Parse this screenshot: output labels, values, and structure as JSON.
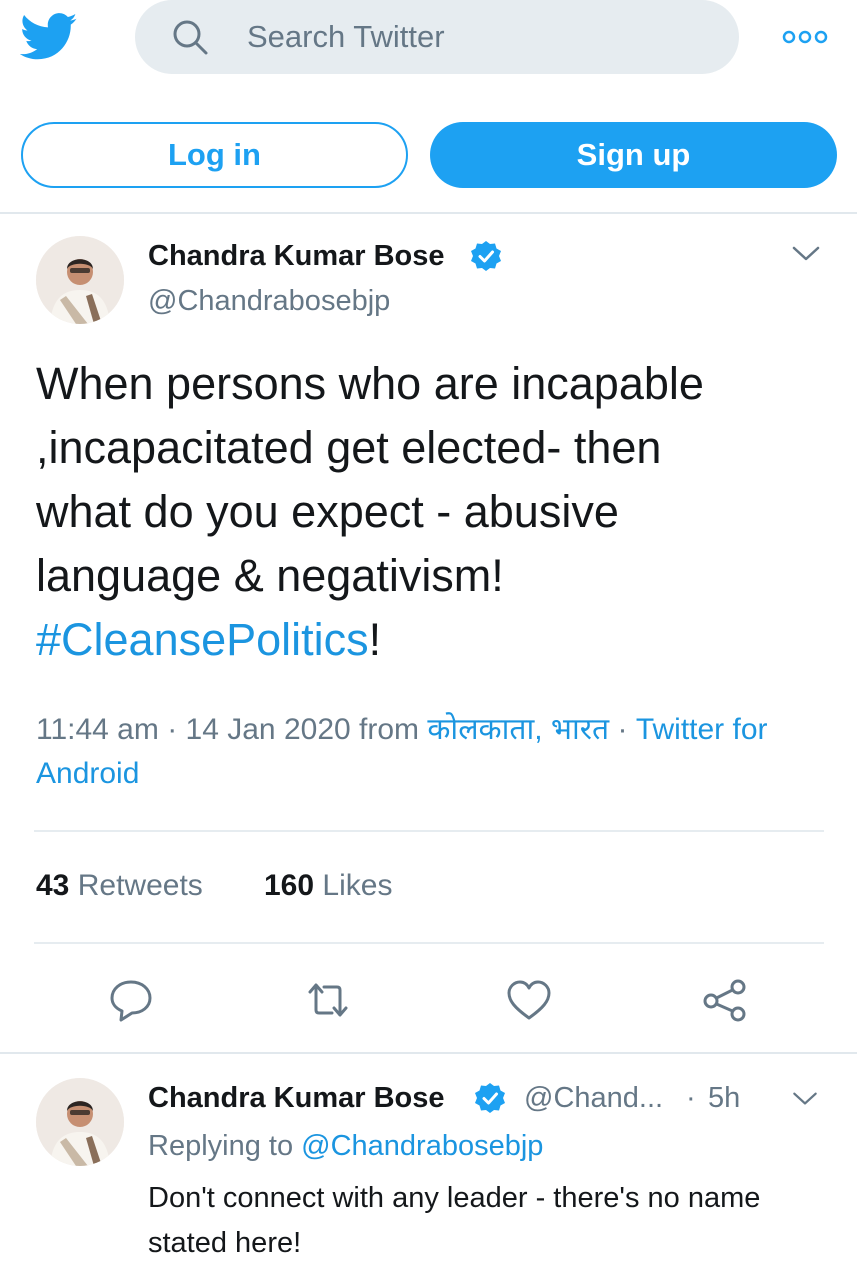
{
  "header": {
    "search_placeholder": "Search Twitter",
    "logo_icon": "twitter-bird-icon",
    "more_icon": "more-dots-icon"
  },
  "auth": {
    "login_label": "Log in",
    "signup_label": "Sign up"
  },
  "tweet": {
    "author_name": "Chandra Kumar Bose",
    "author_handle": "@Chandrabosebjp",
    "text_lines": [
      "When persons who are incapable",
      ",incapacitated get elected- then",
      "what do you expect - abusive",
      "language & negativism!"
    ],
    "hashtag": "#CleansePolitics",
    "hashtag_suffix": "!",
    "time": "11:44 am",
    "separator": "·",
    "date": "14 Jan 2020",
    "from_label": "from",
    "location": "कोलकाता, भारत",
    "client": "Twitter for Android",
    "retweets_count": "43",
    "retweets_label": "Retweets",
    "likes_count": "160",
    "likes_label": "Likes"
  },
  "reply": {
    "author_name": "Chandra Kumar Bose",
    "author_handle": "@Chand...",
    "separator": "·",
    "time": "5h",
    "replying_label": "Replying to",
    "replying_handle": "@Chandrabosebjp",
    "text": "Don't connect with any leader - there's no name stated here!"
  },
  "colors": {
    "brand": "#1da1f2",
    "link": "#1b95e0",
    "muted": "#657786",
    "search_bg": "#e6ecf0"
  }
}
